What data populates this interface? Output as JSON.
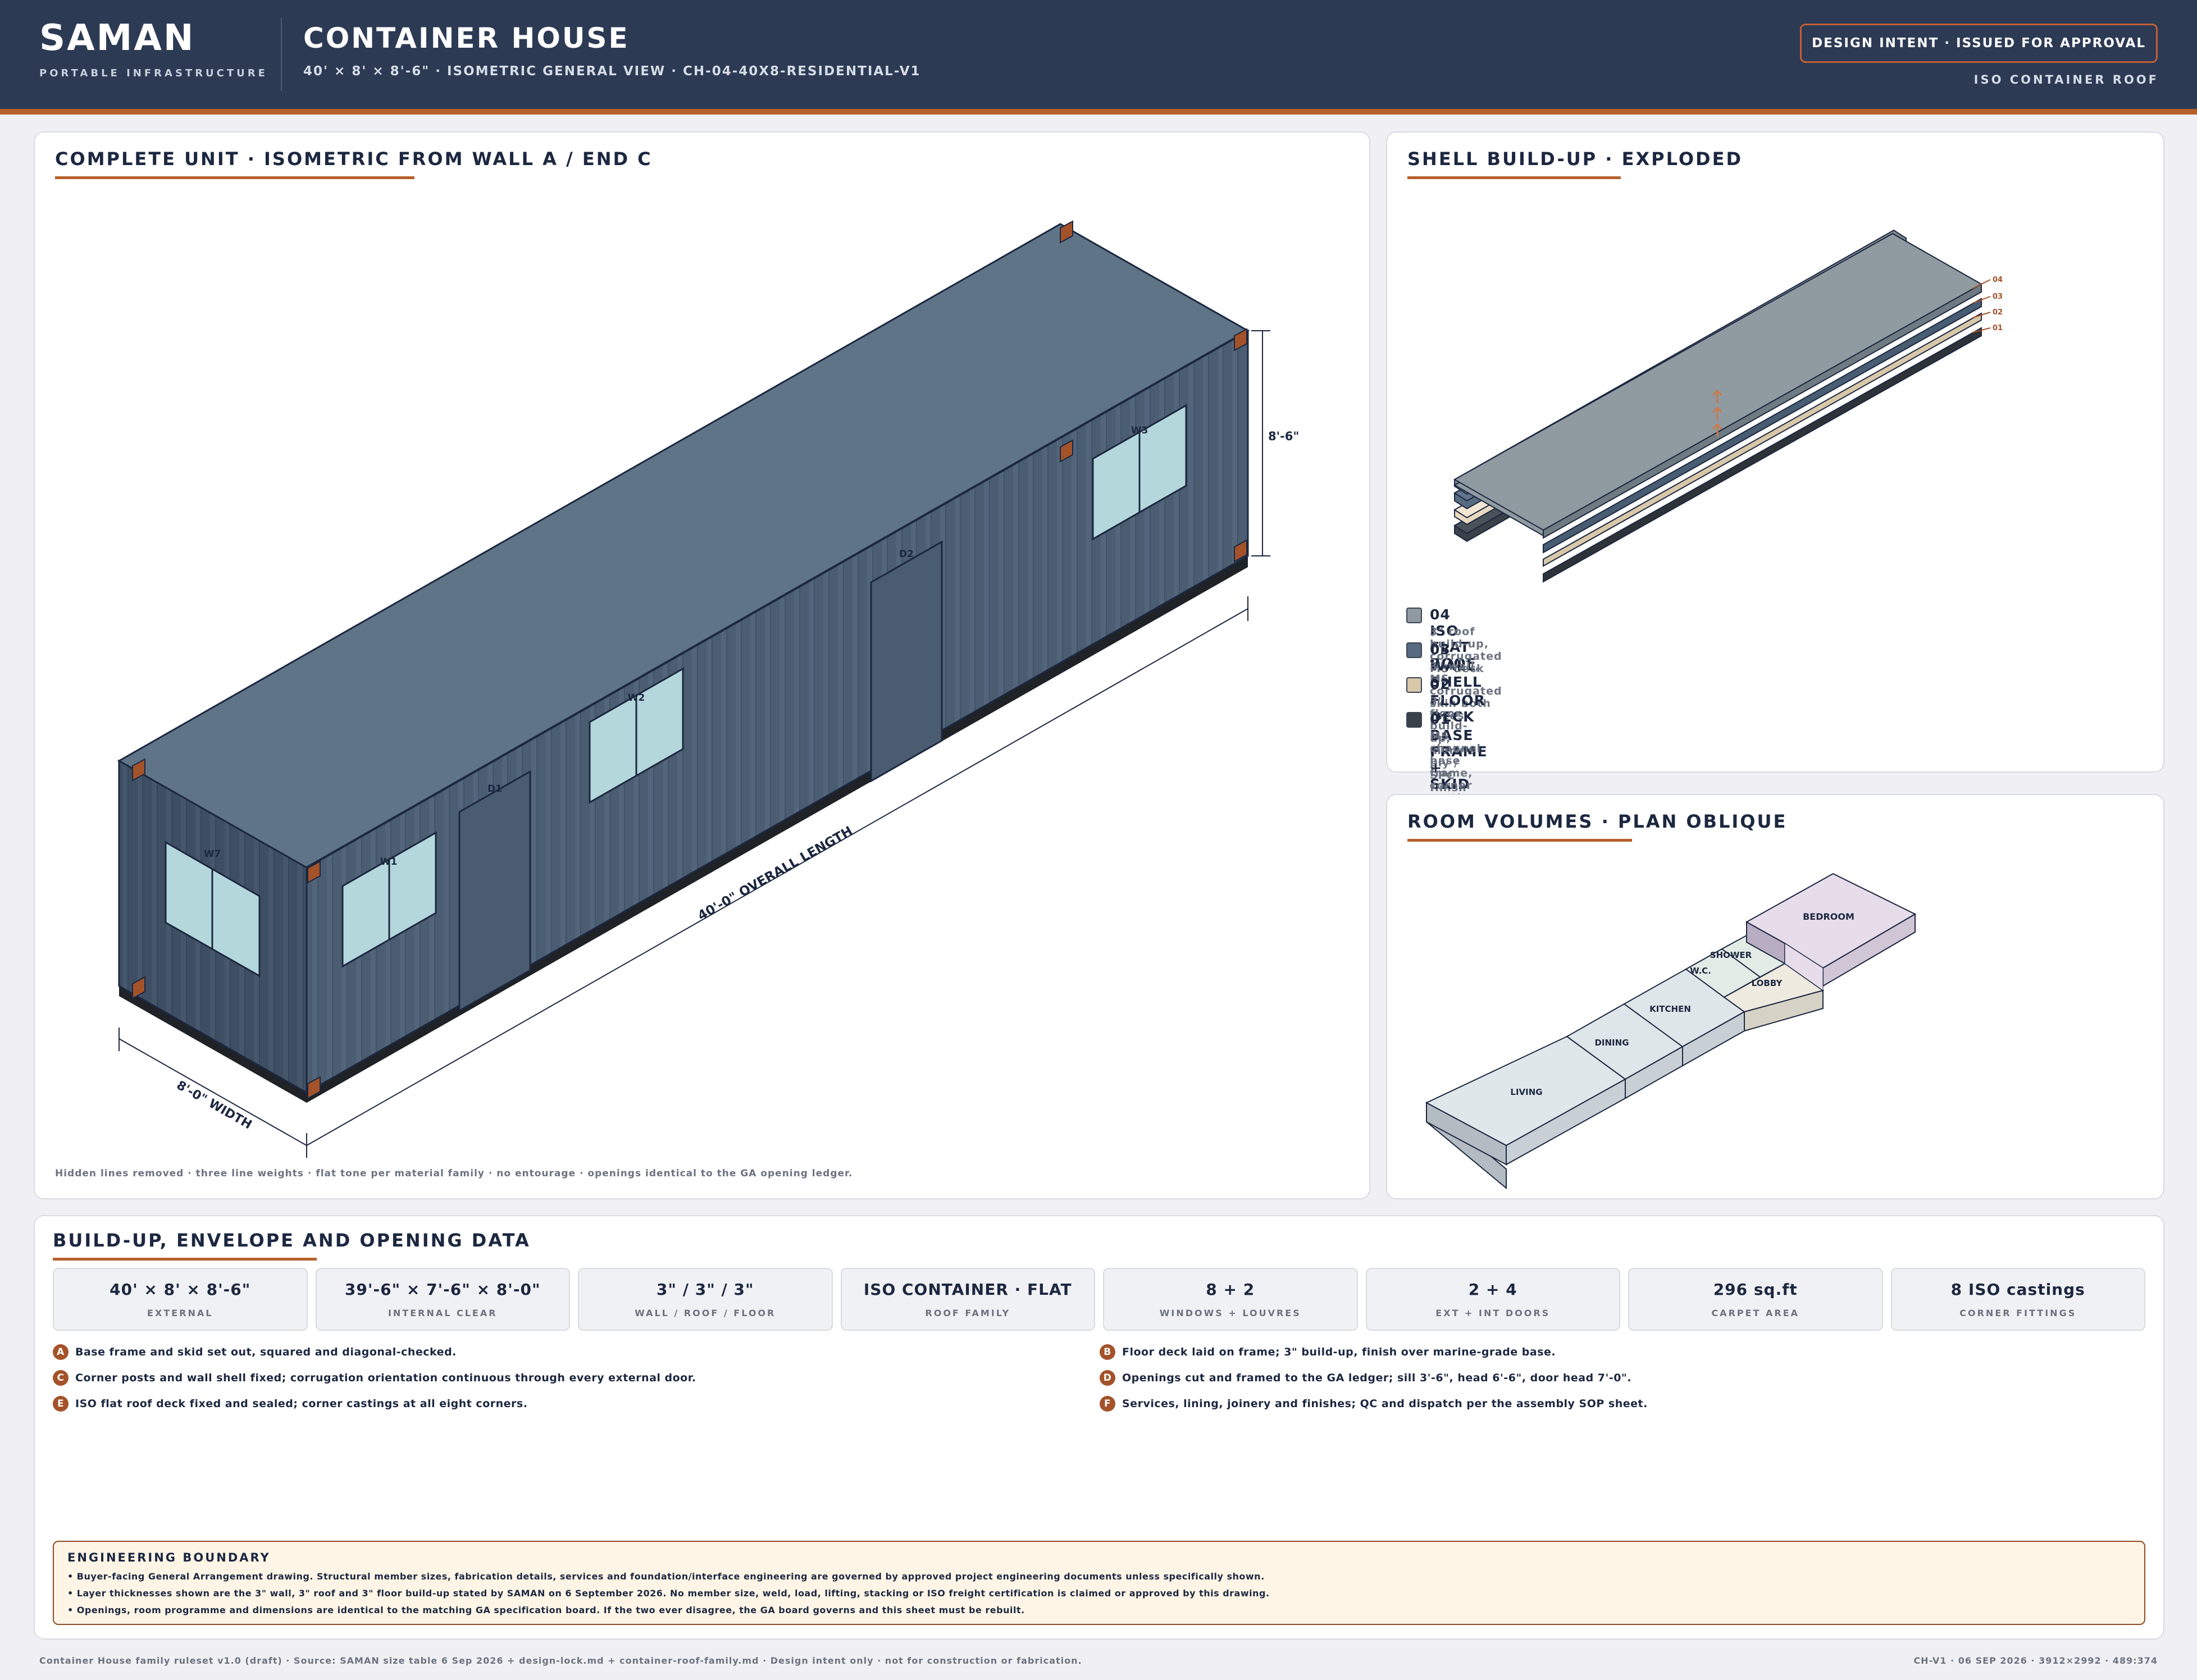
{
  "header": {
    "brand": "SAMAN",
    "brand_sub": "PORTABLE INFRASTRUCTURE",
    "title": "CONTAINER HOUSE",
    "subtitle": "40' × 8' × 8'-6\" · ISOMETRIC GENERAL VIEW · CH-04-40X8-RESIDENTIAL-V1",
    "stamp": "DESIGN INTENT · ISSUED FOR APPROVAL",
    "roof": "ISO CONTAINER ROOF"
  },
  "colors": {
    "accent": "#b6602a",
    "header_bg": "#2c3a54",
    "roof": "#5f7587",
    "wall": "#4b5d71",
    "glass": "#b4d7dc",
    "casting": "#a4522a"
  },
  "iso": {
    "title": "COMPLETE UNIT · ISOMETRIC FROM WALL A / END C",
    "dim_height": "8'-6\"",
    "dim_length": "40'-0\" OVERALL LENGTH",
    "dim_width": "8'-0\" WIDTH",
    "openings": [
      "W7",
      "W1",
      "D1",
      "W2",
      "D2",
      "W3"
    ],
    "caption": "Hidden lines removed · three line weights · flat tone per material family · no entourage · openings identical to the GA opening ledger."
  },
  "shell": {
    "title": "SHELL BUILD-UP · EXPLODED",
    "tags": [
      "04",
      "03",
      "02",
      "01"
    ],
    "layers": [
      {
        "name": "04 ISO FLAT ROOF",
        "desc": "3\" roof build-up, corrugated MS deck",
        "color": "#8f9ba1"
      },
      {
        "name": "03 WALL SHELL",
        "desc": "3\" wall, MS corrugated skin both faces",
        "color": "#566a80"
      },
      {
        "name": "02 FLOOR DECK",
        "desc": "3\" floor build-up, marine ply / SPC finish",
        "color": "#e8d9c0"
      },
      {
        "name": "01 BASE FRAME + SKID",
        "desc": "MS channel base frame, corner castings",
        "color": "#3a4148"
      }
    ]
  },
  "rooms": {
    "title": "ROOM VOLUMES · PLAN OBLIQUE",
    "labels": [
      "BEDROOM",
      "SHOWER",
      "W.C.",
      "LOBBY",
      "KITCHEN",
      "DINING",
      "LIVING"
    ]
  },
  "data": {
    "title": "BUILD-UP, ENVELOPE AND OPENING DATA",
    "cards": [
      {
        "value": "40' × 8' × 8'-6\"",
        "label": "EXTERNAL"
      },
      {
        "value": "39'-6\" × 7'-6\" × 8'-0\"",
        "label": "INTERNAL CLEAR"
      },
      {
        "value": "3\" / 3\" / 3\"",
        "label": "WALL / ROOF / FLOOR"
      },
      {
        "value": "ISO CONTAINER · FLAT",
        "label": "ROOF FAMILY"
      },
      {
        "value": "8 + 2",
        "label": "WINDOWS + LOUVRES"
      },
      {
        "value": "2 + 4",
        "label": "EXT + INT DOORS"
      },
      {
        "value": "296 sq.ft",
        "label": "CARPET AREA"
      },
      {
        "value": "8 ISO castings",
        "label": "CORNER FITTINGS"
      }
    ],
    "steps": [
      {
        "letter": "A",
        "text": "Base frame and skid set out, squared and diagonal-checked."
      },
      {
        "letter": "B",
        "text": "Floor deck laid on frame; 3\" build-up, finish over marine-grade base."
      },
      {
        "letter": "C",
        "text": "Corner posts and wall shell fixed; corrugation orientation continuous through every external door."
      },
      {
        "letter": "D",
        "text": "Openings cut and framed to the GA ledger; sill 3'-6\", head 6'-6\", door head 7'-0\"."
      },
      {
        "letter": "E",
        "text": "ISO flat roof deck fixed and sealed; corner castings at all eight corners."
      },
      {
        "letter": "F",
        "text": "Services, lining, joinery and finishes; QC and dispatch per the assembly SOP sheet."
      }
    ],
    "boundary": {
      "title": "ENGINEERING BOUNDARY",
      "lines": [
        "• Buyer-facing General Arrangement drawing. Structural member sizes, fabrication details, services and foundation/interface engineering are governed by approved project engineering documents unless specifically shown.",
        "• Layer thicknesses shown are the 3\" wall, 3\" roof and 3\" floor build-up stated by SAMAN on 6 September 2026. No member size, weld, load, lifting, stacking or ISO freight certification is claimed or approved by this drawing.",
        "• Openings, room programme and dimensions are identical to the matching GA specification board. If the two ever disagree, the GA board governs and this sheet must be rebuilt."
      ]
    }
  },
  "footer": {
    "left": "Container House family ruleset v1.0 (draft) · Source: SAMAN size table 6 Sep 2026 + design-lock.md + container-roof-family.md · Design intent only · not for construction or fabrication.",
    "right": "CH-V1 · 06 SEP 2026 · 3912×2992 · 489:374"
  }
}
